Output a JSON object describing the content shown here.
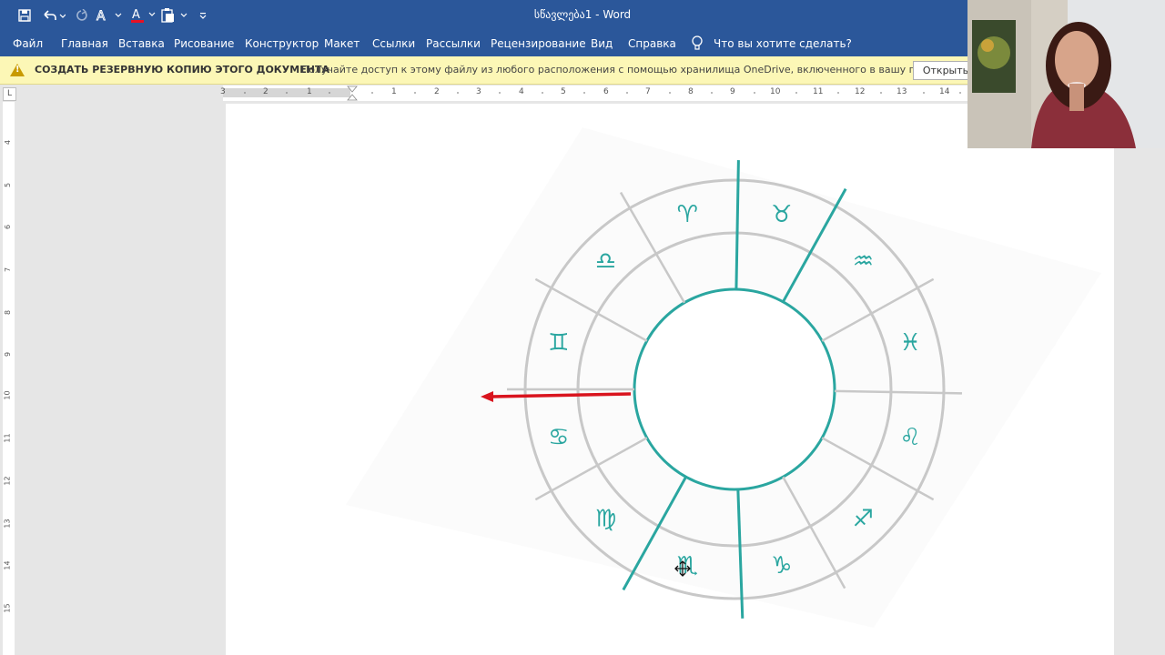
{
  "window": {
    "title": "სწავლება1  -  Word"
  },
  "qat": {
    "save_icon": "save-icon",
    "undo_icon": "undo-icon",
    "redo_icon": "redo-icon",
    "format_icon": "text-effects-icon",
    "font_color_icon": "font-color-icon",
    "paste_icon": "paste-icon"
  },
  "menu": {
    "items": [
      "Файл",
      "Главная",
      "Вставка",
      "Рисование",
      "Конструктор",
      "Макет",
      "Ссылки",
      "Рассылки",
      "Рецензирование",
      "Вид",
      "Справка"
    ],
    "tell_me": "Что вы хотите сделать?"
  },
  "infobar": {
    "title": "СОЗДАТЬ РЕЗЕРВНУЮ КОПИЮ ЭТОГО ДОКУМЕНТА",
    "text": "Получайте доступ к этому файлу из любого расположения с помощью хранилища OneDrive, включенного в вашу подписку.",
    "button": "Открыть"
  },
  "ruler": {
    "corner": "L",
    "h_left_ticks": [
      "3",
      "2",
      "1"
    ],
    "h_right_ticks": [
      "1",
      "2",
      "3",
      "4",
      "5",
      "6",
      "7",
      "8",
      "9",
      "10",
      "11",
      "12",
      "13",
      "14"
    ],
    "v_ticks": [
      "4",
      "5",
      "6",
      "7",
      "8",
      "9",
      "10",
      "11",
      "12",
      "13",
      "14",
      "15"
    ]
  },
  "wheel": {
    "symbols": [
      "♈",
      "♉",
      "♊",
      "♋",
      "♌",
      "♍",
      "♎",
      "♏",
      "♐",
      "♑",
      "♒",
      "♓"
    ],
    "line_color": "#2aa6a0",
    "ring_color": "#c8c8c8",
    "arrow_color": "#d9141e"
  },
  "colors": {
    "accent": "#2b579a",
    "infobar": "#fcf7b6"
  }
}
